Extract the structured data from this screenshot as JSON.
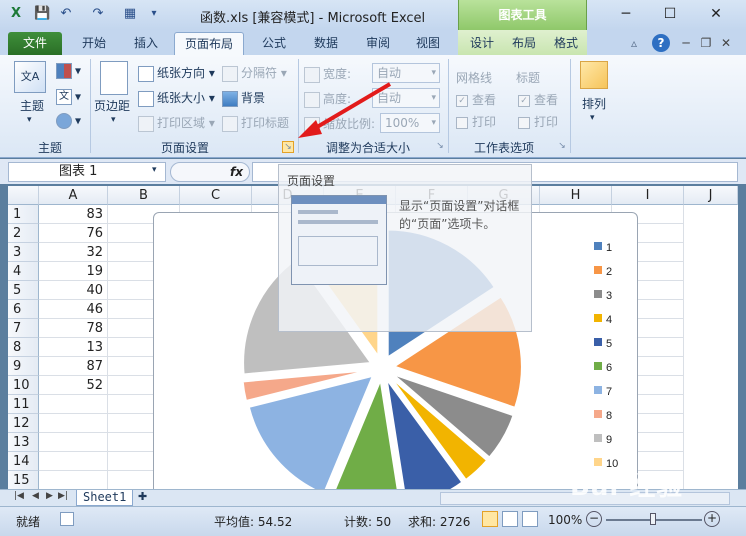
{
  "window": {
    "title": "函数.xls  [兼容模式] - Microsoft Excel",
    "chart_tools_label": "图表工具",
    "minimize": "─",
    "maximize": "☐",
    "close": "✕"
  },
  "tabs": {
    "file": "文件",
    "items": [
      "开始",
      "插入",
      "页面布局",
      "公式",
      "数据",
      "审阅",
      "视图"
    ],
    "context_items": [
      "设计",
      "布局",
      "格式"
    ],
    "active_index": 2
  },
  "ribbon": {
    "themes": {
      "btn": "主题",
      "group": "主题"
    },
    "page_setup": {
      "margins": "页边距",
      "orientation": "纸张方向",
      "size": "纸张大小",
      "print_area": "打印区域",
      "breaks": "分隔符",
      "background": "背景",
      "print_titles": "打印标题",
      "group": "页面设置"
    },
    "scale": {
      "width_label": "宽度:",
      "width_value": "自动",
      "height_label": "高度:",
      "height_value": "自动",
      "scale_label": "缩放比例:",
      "scale_value": "100%",
      "group": "调整为合适大小"
    },
    "sheet_options": {
      "gridlines": "网格线",
      "headings": "标题",
      "view": "查看",
      "print": "打印",
      "group": "工作表选项"
    },
    "arrange": {
      "btn": "排列"
    }
  },
  "formula_bar": {
    "name_box": "图表 1",
    "fx": "fx",
    "content": ""
  },
  "tooltip": {
    "title": "页面设置",
    "text": "显示“页面设置”对话框的“页面”选项卡。"
  },
  "columns": [
    "A",
    "B",
    "C",
    "D",
    "E",
    "F",
    "G",
    "H",
    "I",
    "J"
  ],
  "rows": [
    "1",
    "2",
    "3",
    "4",
    "5",
    "6",
    "7",
    "8",
    "9",
    "10",
    "11",
    "12",
    "13",
    "14",
    "15"
  ],
  "cells_a": [
    "83",
    "76",
    "32",
    "19",
    "40",
    "46",
    "78",
    "13",
    "87",
    "52"
  ],
  "sheet_tab": "Sheet1",
  "status": {
    "ready": "就绪",
    "average": "平均值: 54.52",
    "count": "计数: 50",
    "sum": "求和: 2726",
    "zoom": "100%"
  },
  "watermark": "Bai 经验",
  "chart_data": {
    "type": "pie",
    "exploded": true,
    "categories": [
      "1",
      "2",
      "3",
      "4",
      "5",
      "6",
      "7",
      "8",
      "9",
      "10"
    ],
    "values": [
      83,
      76,
      32,
      19,
      40,
      46,
      78,
      13,
      87,
      52
    ],
    "colors": [
      "#4f81bd",
      "#f79646",
      "#8c8c8c",
      "#f2b400",
      "#3a5fa8",
      "#70ad47",
      "#8db3e2",
      "#f5a88a",
      "#bfbfbf",
      "#ffd58a"
    ],
    "legend_position": "right",
    "title": ""
  }
}
